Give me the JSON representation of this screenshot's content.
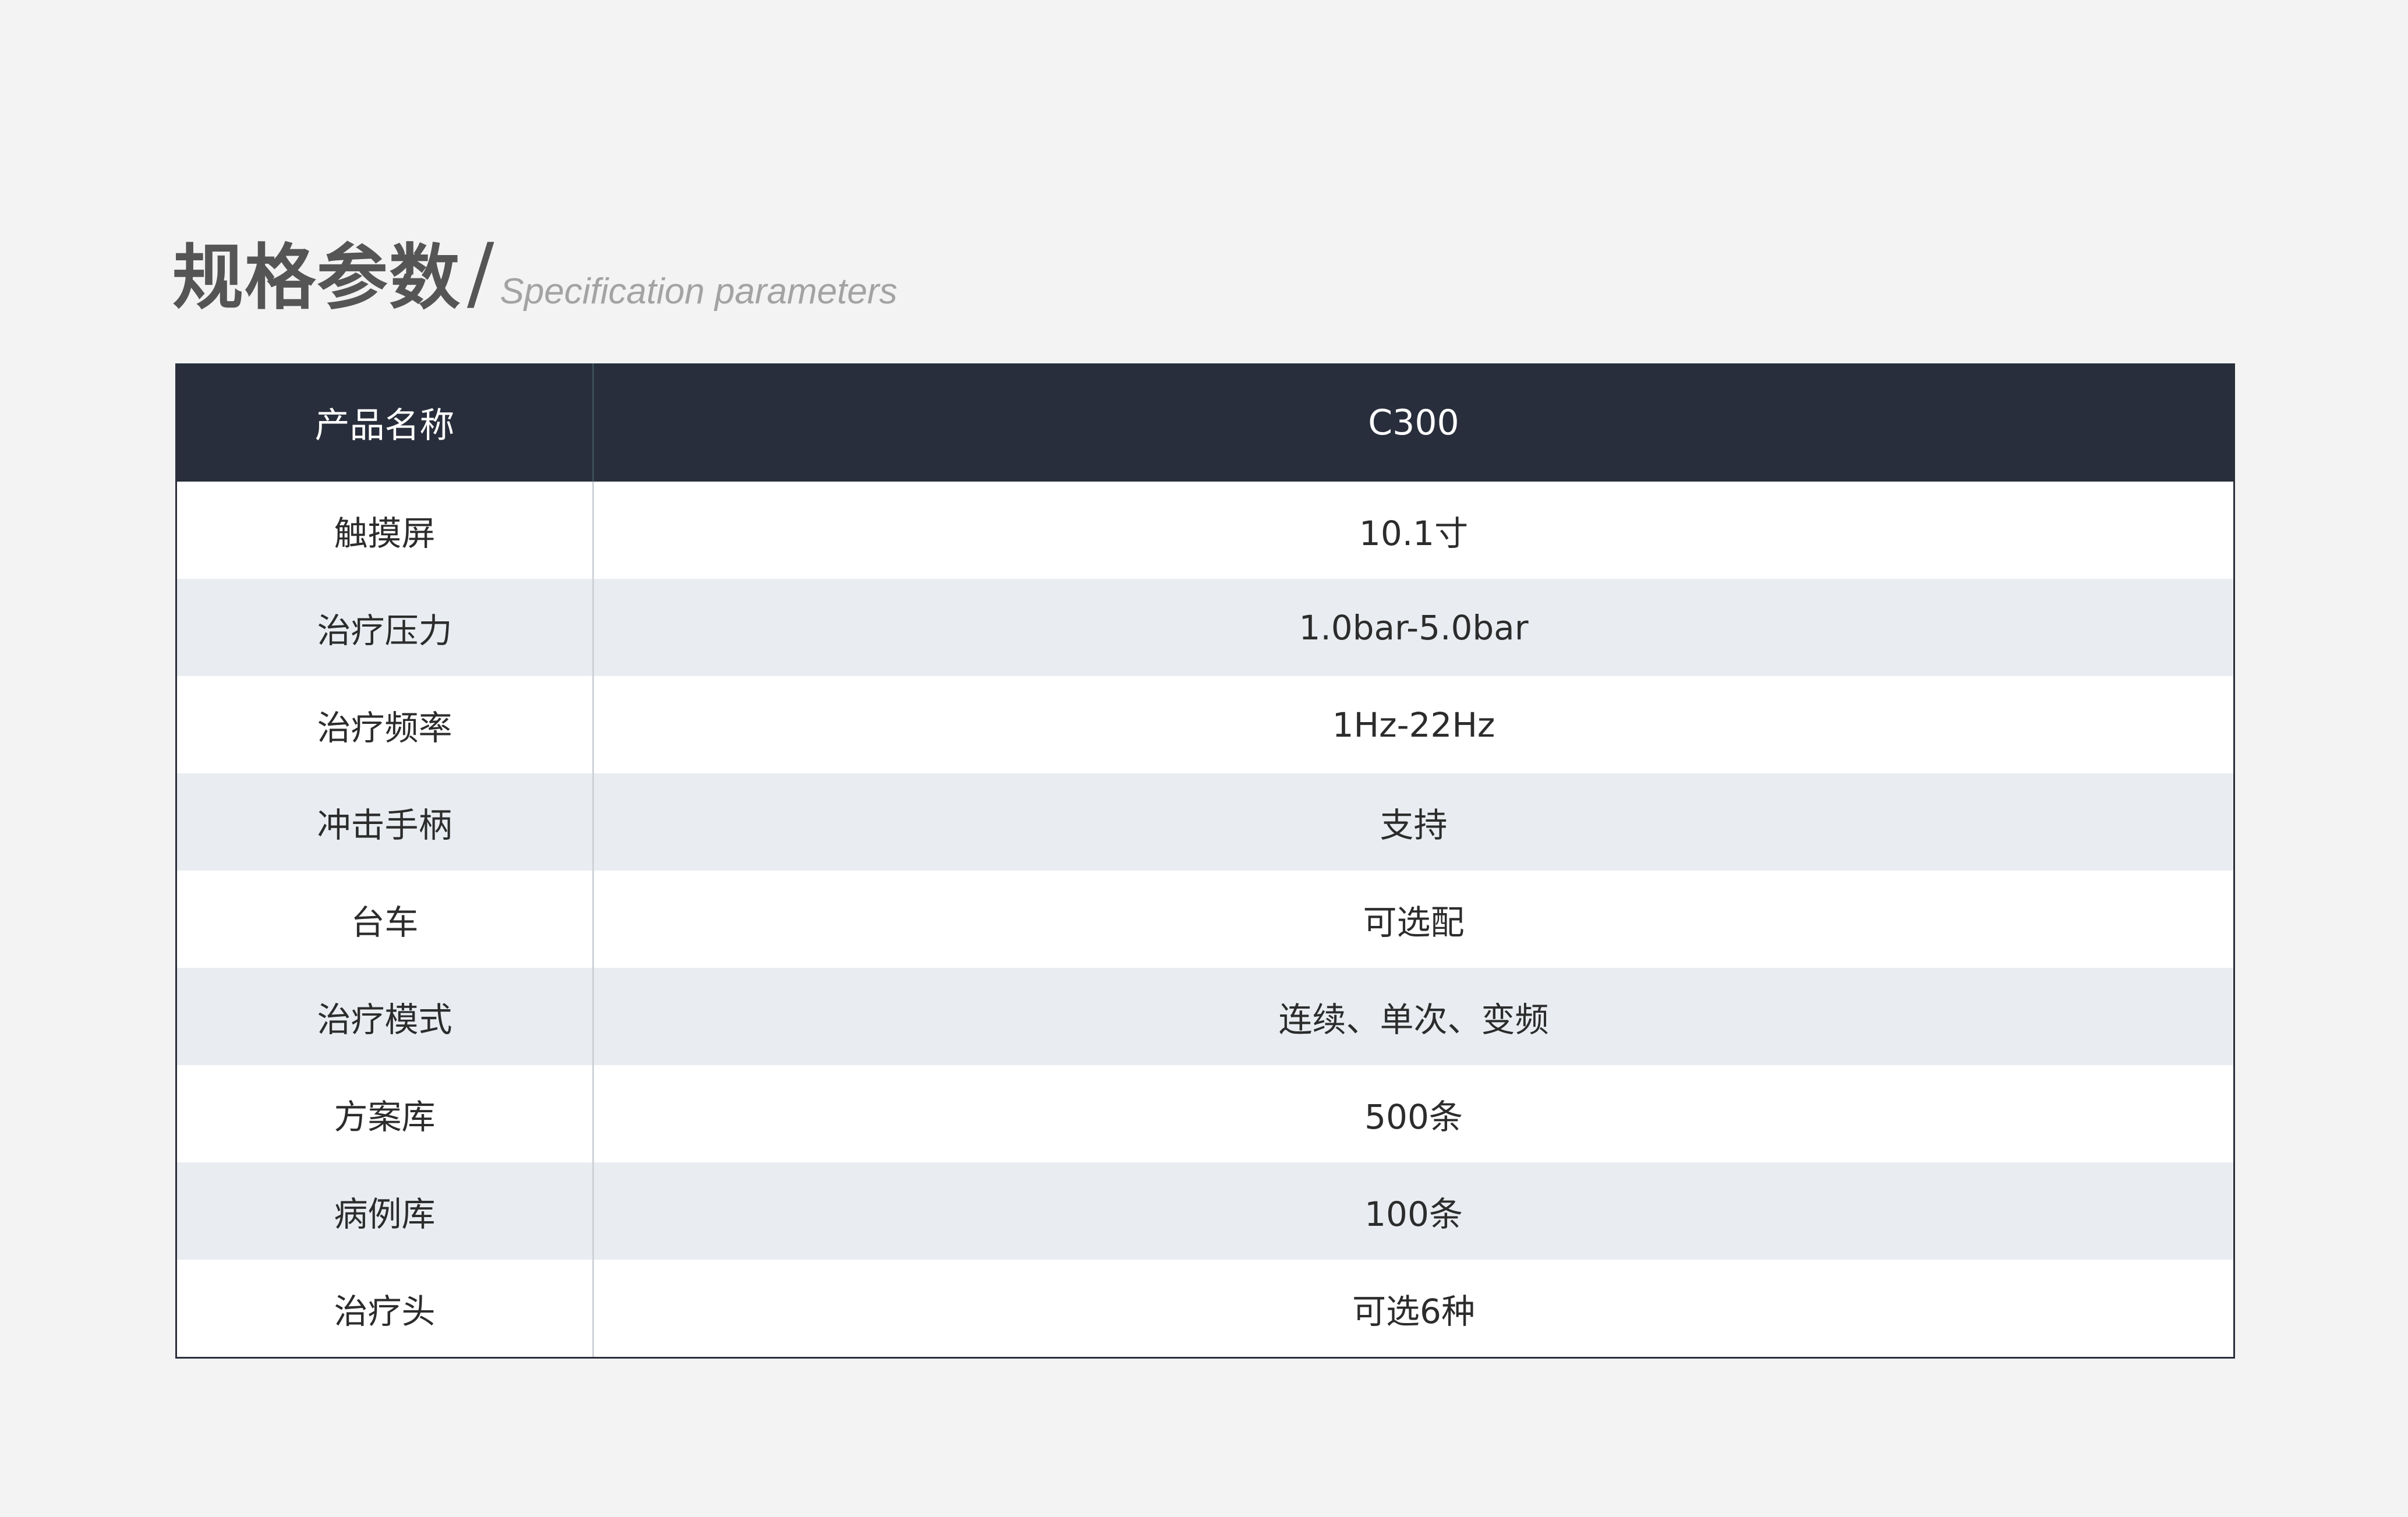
{
  "heading": {
    "title_cn": "规格参数",
    "slash": "/",
    "title_en": "Specification parameters"
  },
  "table": {
    "header": {
      "label": "产品名称",
      "value": "C300"
    },
    "rows": [
      {
        "label": "触摸屏",
        "value": "10.1寸"
      },
      {
        "label": "治疗压力",
        "value": "1.0bar-5.0bar"
      },
      {
        "label": "治疗频率",
        "value": "1Hz-22Hz"
      },
      {
        "label": "冲击手柄",
        "value": "支持"
      },
      {
        "label": "台车",
        "value": "可选配"
      },
      {
        "label": "治疗模式",
        "value": "连续、单次、变频"
      },
      {
        "label": "方案库",
        "value": "500条"
      },
      {
        "label": "病例库",
        "value": "100条"
      },
      {
        "label": "治疗头",
        "value": "可选6种"
      }
    ]
  },
  "colors": {
    "background": "#f3f3f3",
    "header_bg": "#282e3b",
    "alt_row_bg": "#e9edf1",
    "title": "#555555",
    "subtitle": "#a3a3a3"
  }
}
